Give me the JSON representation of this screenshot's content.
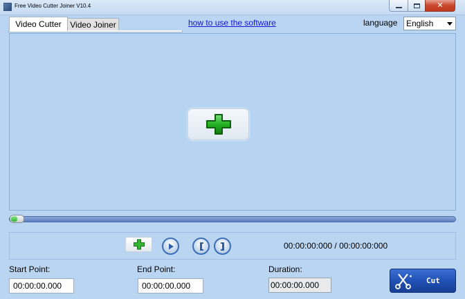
{
  "window": {
    "title": "Free Video Cutter Joiner V10.4"
  },
  "tabs": [
    {
      "label": "Video Cutter",
      "active": true
    },
    {
      "label": "Video Joiner",
      "active": false
    }
  ],
  "header": {
    "help_link": "how to use the software",
    "language_label": "language",
    "language_value": "English"
  },
  "controls": {
    "time_display": "00:00:00:000 / 00:00:00:000",
    "icons": [
      "add-icon",
      "play-icon",
      "set-start-icon",
      "set-end-icon"
    ]
  },
  "fields": {
    "start_label": "Start Point:",
    "start_value": "00:00:00.000",
    "end_label": "End Point:",
    "end_value": "00:00:00.000",
    "duration_label": "Duration:",
    "duration_value": "00:00:00.000"
  },
  "cut_button": {
    "label": "Cut"
  },
  "colors": {
    "background": "#b9d5f1",
    "link": "#1a12d6",
    "cut_button": "#1f4fb2",
    "add_icon": "#22b322"
  }
}
